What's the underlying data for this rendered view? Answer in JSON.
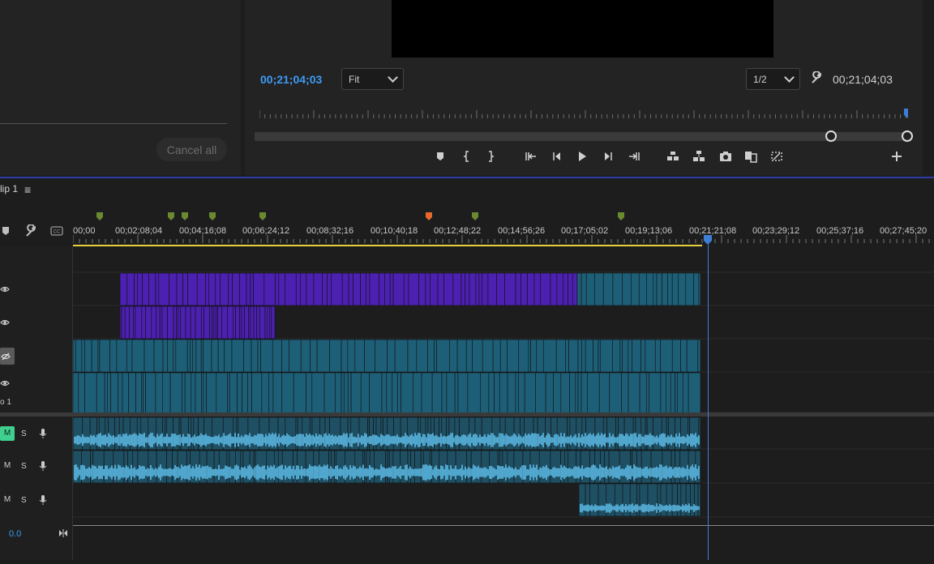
{
  "source_panel": {
    "cancel_all_label": "Cancel all"
  },
  "program_monitor": {
    "timecode_current": "00;21;04;03",
    "zoom_value": "Fit",
    "resolution_value": "1/2",
    "timecode_duration": "00;21;04;03",
    "controls": [
      "add-marker",
      "mark-in",
      "mark-out",
      "go-to-in",
      "step-back",
      "play",
      "step-forward",
      "go-to-out",
      "lift",
      "extract",
      "export-frame",
      "compare-view",
      "trim-mode",
      "add-button"
    ]
  },
  "timeline": {
    "sequence_tab": "lip 1",
    "ruler_labels": [
      "00;00",
      "00;02;08;04",
      "00;04;16;08",
      "00;06;24;12",
      "00;08;32;16",
      "00;10;40;18",
      "00;12;48;22",
      "00;14;56;26",
      "00;17;05;02",
      "00;19;13;06",
      "00;21;21;08",
      "00;23;29;12",
      "00;25;37;16",
      "00;27;45;20"
    ],
    "track_label_v1": "o 1",
    "audio_tracks": [
      {
        "m": "M",
        "s": "S",
        "m_active": true
      },
      {
        "m": "M",
        "s": "S",
        "m_active": false
      },
      {
        "m": "M",
        "s": "S",
        "m_active": false
      }
    ],
    "master_value": "0.0",
    "colors": {
      "video_purple": "#4c20b0",
      "video_teal": "#1e5f78",
      "audio": "#5dbde8",
      "marker_green": "#6a8a30",
      "marker_orange": "#e8672a",
      "playhead": "#3d7ed6",
      "work_area": "#e4d13c"
    }
  }
}
